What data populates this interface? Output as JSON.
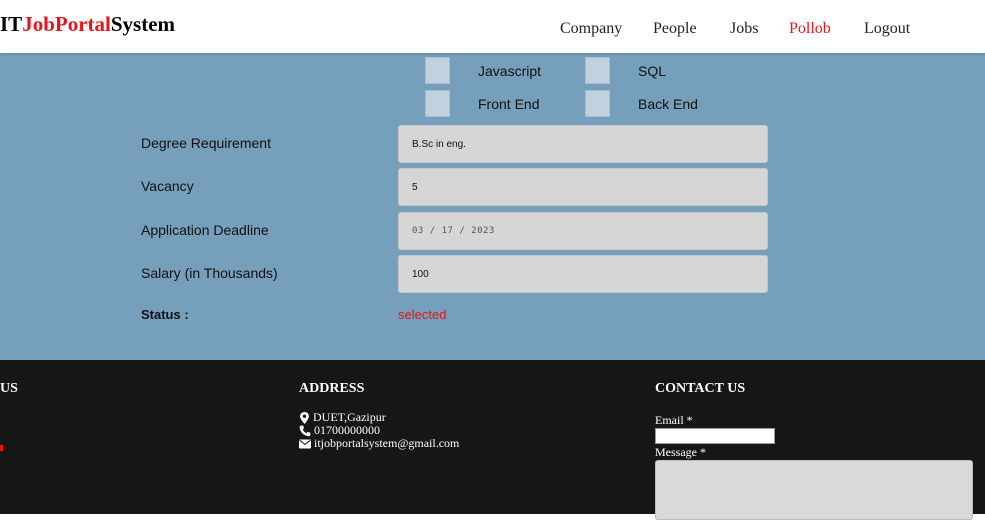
{
  "brand": {
    "part1": "IT",
    "part2": "JobPortal",
    "part3": "System"
  },
  "nav": [
    {
      "label": "Company",
      "active": false
    },
    {
      "label": "People",
      "active": false
    },
    {
      "label": "Jobs",
      "active": false
    },
    {
      "label": "Pollob",
      "active": true
    },
    {
      "label": "Logout",
      "active": false
    }
  ],
  "skills": {
    "javascript": "Javascript",
    "sql": "SQL",
    "front_end": "Front End",
    "back_end": "Back End"
  },
  "form": {
    "degree": {
      "label": "Degree Requirement",
      "value": "B.Sc in eng."
    },
    "vacancy": {
      "label": "Vacancy",
      "value": "5"
    },
    "deadline": {
      "label": "Application Deadline",
      "value": "03 / 17 / 2023"
    },
    "salary": {
      "label": "Salary (in Thousands)",
      "value": "100"
    },
    "status": {
      "label": "Status :",
      "value": "selected"
    }
  },
  "footer": {
    "about_heading": "US",
    "address_heading": "ADDRESS",
    "contact_heading": "CONTACT US",
    "location": "DUET,Gazipur",
    "phone": "01700000000",
    "email": "itjobportalsystem@gmail.com",
    "email_label": "Email *",
    "message_label": "Message *"
  },
  "colors": {
    "accent_red": "#e8141a",
    "form_background": "#759fbb",
    "footer_background": "#161616"
  }
}
